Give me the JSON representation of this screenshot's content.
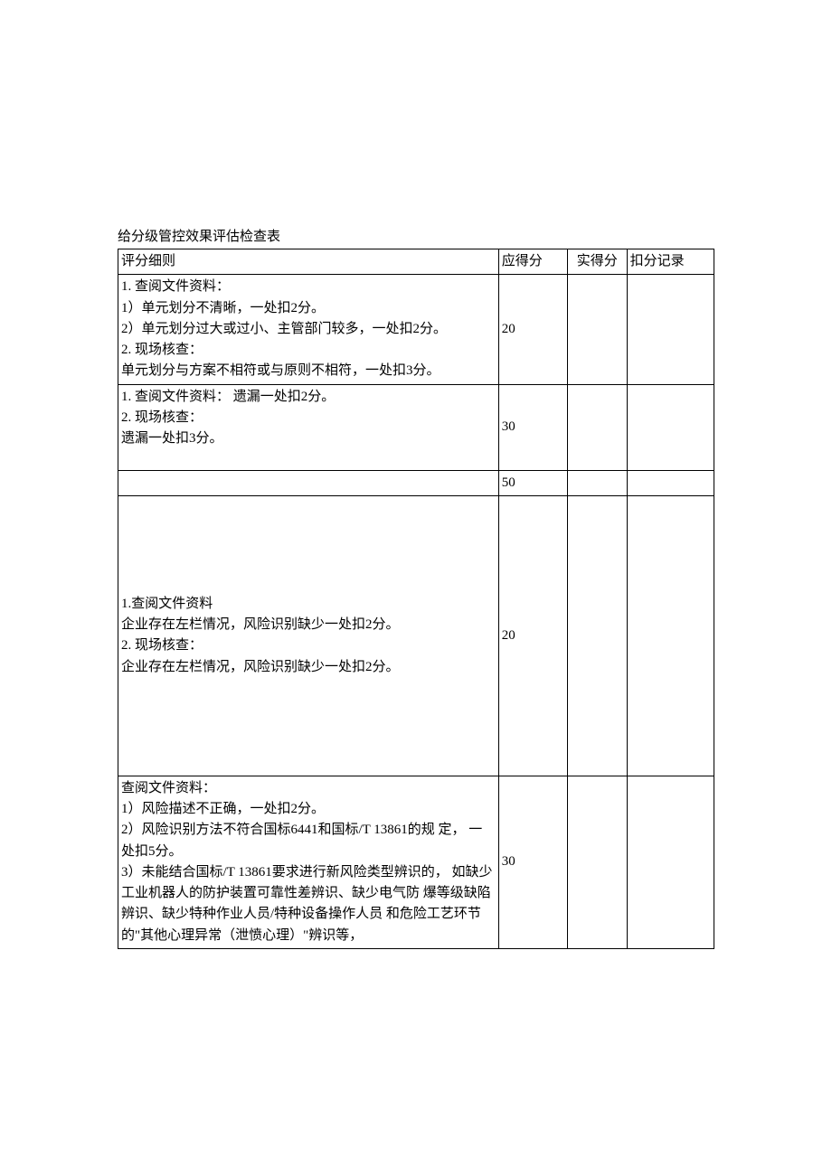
{
  "title": "给分级管控效果评估检查表",
  "headers": {
    "criteria": "评分细则",
    "due_score": "应得分",
    "actual_score": "实得分",
    "deduction_record": "扣分记录"
  },
  "rows": [
    {
      "criteria": "1. 查阅文件资料：\n1）单元划分不清晰，一处扣2分。\n2）单元划分过大或过小、主管部门较多，一处扣2分。\n2. 现场核查：\n单元划分与方案不相符或与原则不相符，一处扣3分。",
      "due_score": "20",
      "actual_score": "",
      "deduction_record": ""
    },
    {
      "criteria": "1. 查阅文件资料：   遗漏一处扣2分。\n2. 现场核查：\n遗漏一处扣3分。\n",
      "due_score": "30",
      "actual_score": "",
      "deduction_record": ""
    },
    {
      "criteria": "",
      "due_score": "50",
      "actual_score": "",
      "deduction_record": ""
    },
    {
      "criteria": "1.查阅文件资料\n企业存在左栏情况，风险识别缺少一处扣2分。\n2. 现场核查：\n企业存在左栏情况，风险识别缺少一处扣2分。",
      "due_score": "20",
      "actual_score": "",
      "deduction_record": ""
    },
    {
      "criteria": "查阅文件资料：\n1）风险描述不正确，一处扣2分。\n2）风险识别方法不符合国标6441和国标/T 13861的规 定， 一处扣5分。\n3）未能结合国标/T 13861要求进行新风险类型辨识的，    如缺少工业机器人的防护装置可靠性差辨识、缺少电气防 爆等级缺陷辨识、缺少特种作业人员/特种设备操作人员 和危险工艺环节的\"其他心理异常（泄愤心理）\"辨识等，",
      "due_score": "30",
      "actual_score": "",
      "deduction_record": ""
    }
  ]
}
